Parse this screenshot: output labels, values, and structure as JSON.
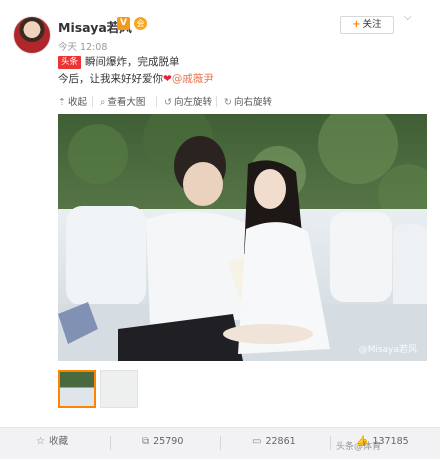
{
  "post": {
    "username": "Misaya若风",
    "verified_badge": "V",
    "member_icon": "会",
    "timestamp": "今天 12:08",
    "follow_label": "关注",
    "follow_plus": "+",
    "line1_tag": "头条",
    "line1_text": "瞬间爆炸，完成脱单",
    "line2_text": "今后，让我来好好爱你",
    "line2_heart": "❤",
    "mention": "@戚薇尹",
    "colors": {
      "accent": "#ff8200",
      "mention": "#eb7350",
      "heart": "#e5223b",
      "tag_bg": "#e33"
    }
  },
  "media_toolbar": {
    "collapse": "收起",
    "view_large": "查看大图",
    "rotate_left": "向左旋转",
    "rotate_right": "向右旋转"
  },
  "photo": {
    "watermark": "@Misaya若风"
  },
  "footer": {
    "favorite": "收藏",
    "repost_count": "25790",
    "comment_count": "22861",
    "like_count": "137185",
    "watermark": "头条@体育"
  },
  "icons": {
    "favorite": "star-icon",
    "repost": "repost-icon",
    "comment": "comment-icon",
    "like": "thumbs-up-icon"
  }
}
